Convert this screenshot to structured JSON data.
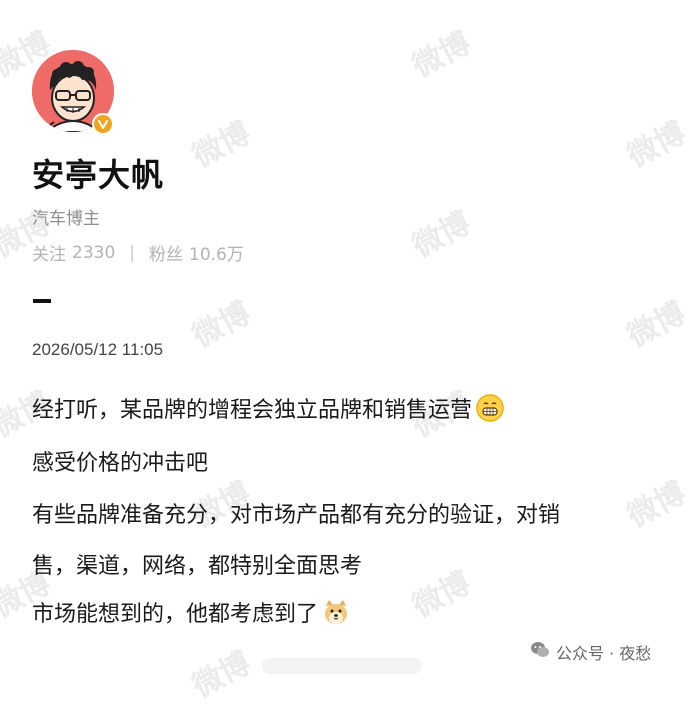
{
  "watermark_text": "微博",
  "profile": {
    "name": "安亭大帆",
    "bio": "汽车博主",
    "following_label": "关注",
    "following_count": "2330",
    "followers_label": "粉丝",
    "followers_count": "10.6万"
  },
  "post": {
    "timestamp": "2026/05/12 11:05",
    "lines": [
      "经打听，某品牌的增程会独立品牌和销售运营",
      "感受价格的冲击吧",
      "有些品牌准备充分，对市场产品都有充分的验证，对销",
      "售，渠道，网络，都特别全面思考",
      "市场能想到的，他都考虑到了"
    ],
    "emoji_1": "grin-emoji",
    "emoji_2": "doge-emoji"
  },
  "footer": {
    "source": "公众号 · 夜愁"
  },
  "colors": {
    "avatar_bg": "#ee6b67",
    "verify_badge": "#f3a21c",
    "watermark": "#ebebeb"
  }
}
